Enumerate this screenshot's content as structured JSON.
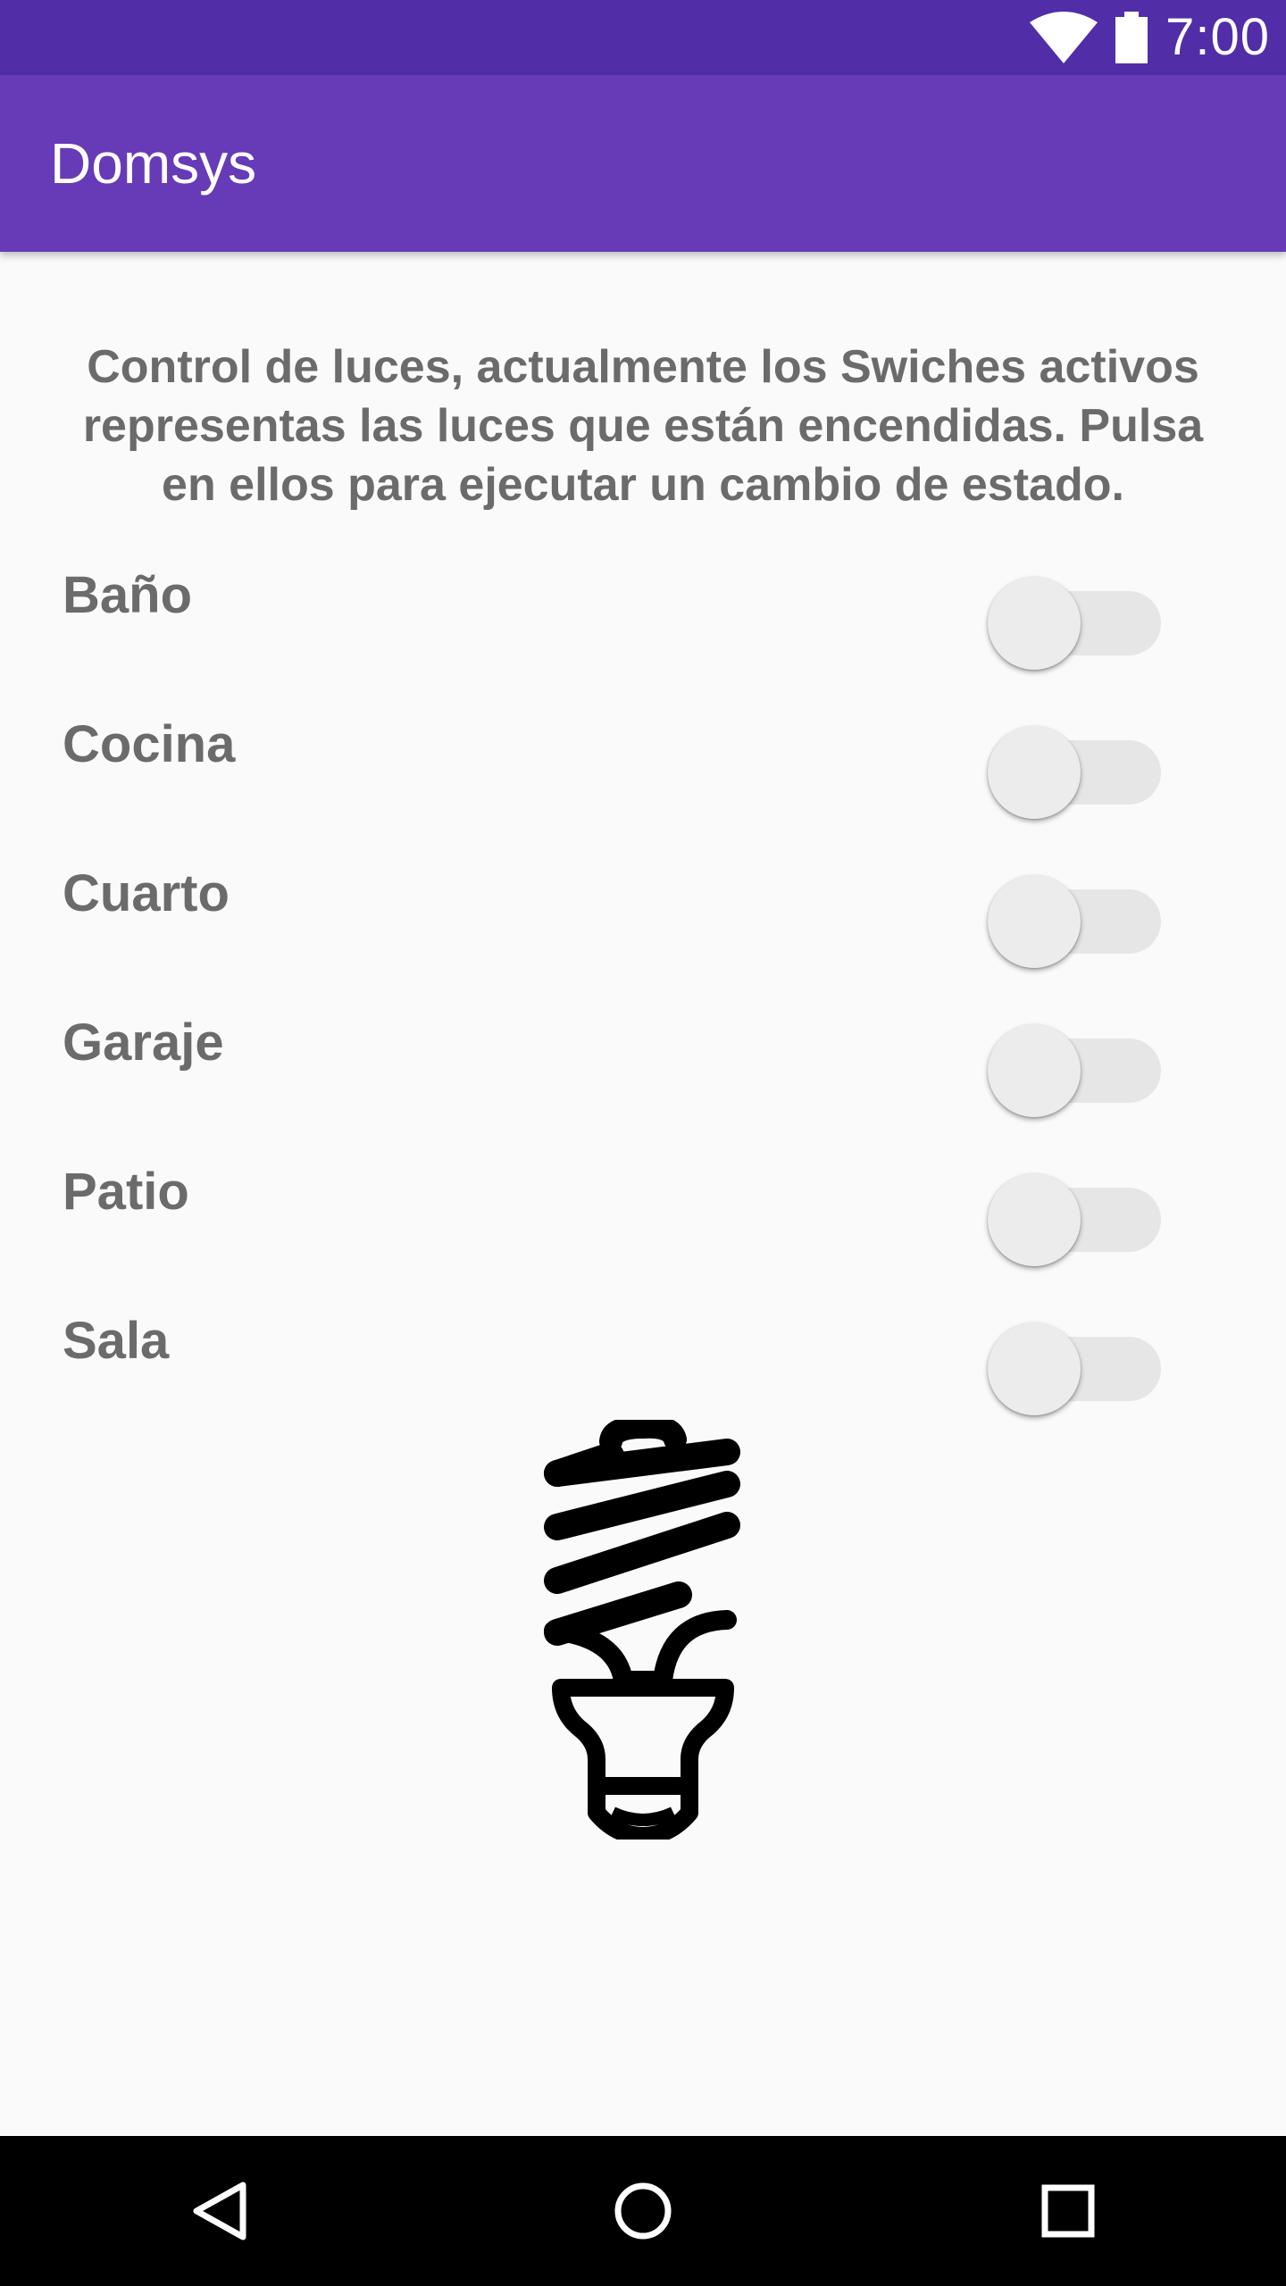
{
  "status_bar": {
    "time": "7:00",
    "icons": [
      "wifi-icon",
      "battery-icon"
    ]
  },
  "app_bar": {
    "title": "Domsys",
    "color": "#673ab7",
    "status_color": "#512da8"
  },
  "intro_text": "Control de luces, actualmente los Swiches activos representas las luces que están encendidas. Pulsa en ellos para ejecutar un cambio de estado.",
  "lights": [
    {
      "label": "Baño",
      "on": false
    },
    {
      "label": "Cocina",
      "on": false
    },
    {
      "label": "Cuarto",
      "on": false
    },
    {
      "label": "Garaje",
      "on": false
    },
    {
      "label": "Patio",
      "on": false
    },
    {
      "label": "Sala",
      "on": false
    }
  ],
  "illustration": "lightbulb-icon",
  "nav_bar": {
    "buttons": [
      "back-icon",
      "home-icon",
      "recents-icon"
    ]
  }
}
